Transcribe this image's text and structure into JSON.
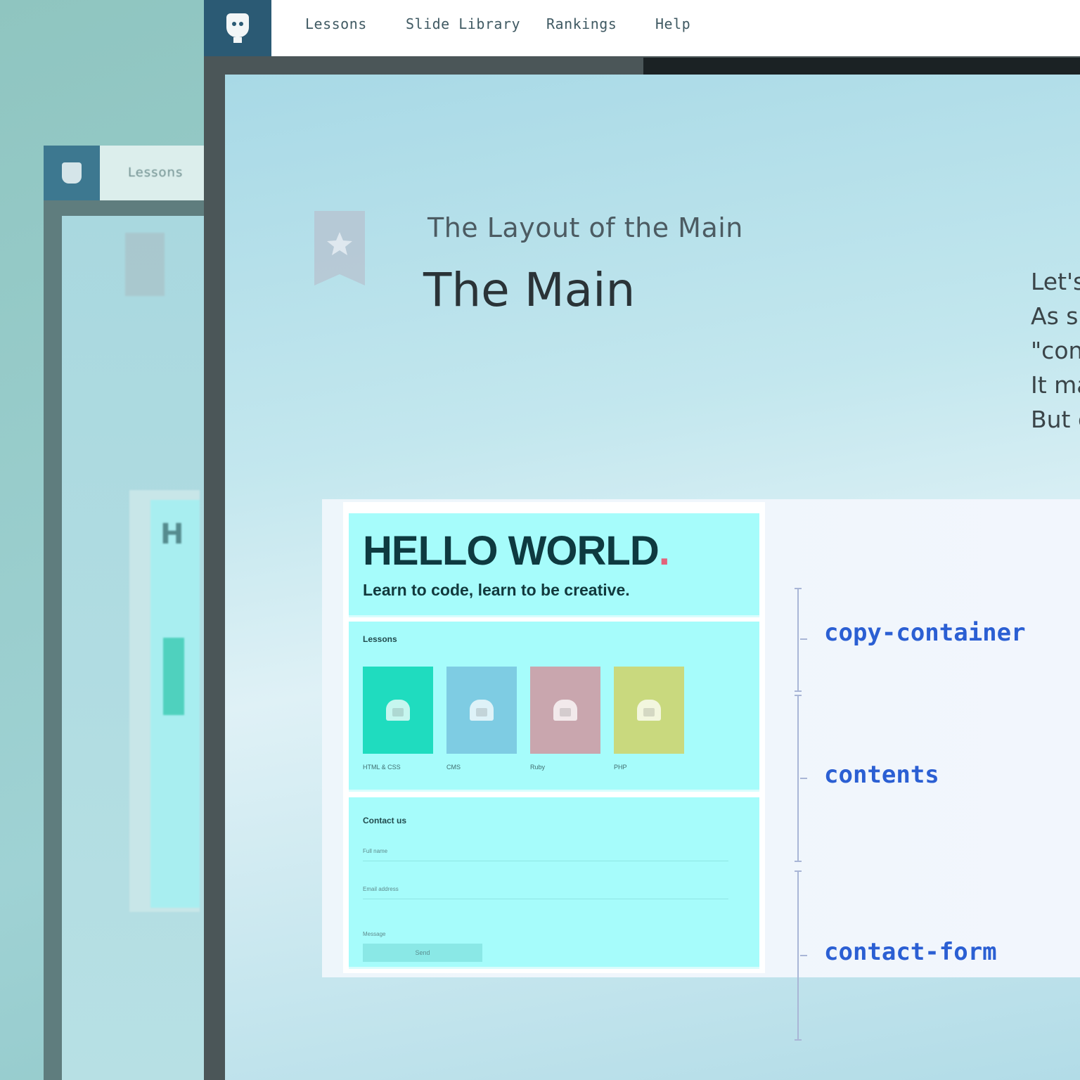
{
  "background_window": {
    "nav_item": "Lessons",
    "card_partial_text": "H"
  },
  "nav": {
    "items": [
      "Lessons",
      "Slide Library",
      "Rankings",
      "Help"
    ]
  },
  "slide": {
    "subtitle": "The Layout of the Main",
    "title": "The Main",
    "side_text_lines": [
      "Let's",
      "As sl",
      "\"con",
      "It ma",
      "But c"
    ]
  },
  "mockup": {
    "hero_title": "HELLO WORLD",
    "hero_title_dot": ".",
    "hero_subtitle": "Learn to code, learn to be creative.",
    "contents_label": "Lessons",
    "tiles": [
      {
        "color": "#1fdcbf",
        "caption": "HTML & CSS"
      },
      {
        "color": "#7ecce3",
        "caption": "CMS"
      },
      {
        "color": "#c9a6ae",
        "caption": "Ruby"
      },
      {
        "color": "#c9d97e",
        "caption": "PHP"
      }
    ],
    "contact_label": "Contact us",
    "contact_fields": [
      "Full name",
      "Email address",
      "Message"
    ],
    "send_label": "Send"
  },
  "labels": {
    "copy_container": "copy-container",
    "contents": "contents",
    "contact_form": "contact-form"
  },
  "colors": {
    "accent_blue": "#2b5fd3",
    "logo_box": "#2b5a74",
    "mock_cyan": "#a6fcfb"
  },
  "icons": [
    "app-logo-icon",
    "bookmark-star-icon",
    "lesson-tile-icon"
  ]
}
